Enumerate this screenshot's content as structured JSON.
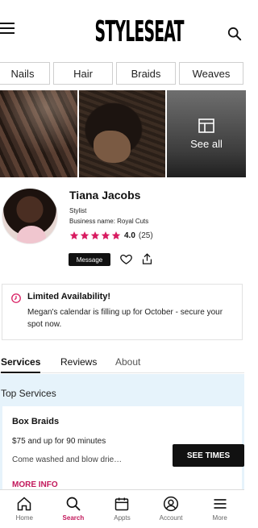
{
  "header": {
    "logo": "STYLESEAT"
  },
  "categories": [
    "Nails",
    "Hair",
    "Braids",
    "Weaves"
  ],
  "photos": {
    "see_all_label": "See all"
  },
  "profile": {
    "name": "Tiana Jacobs",
    "role": "Stylist",
    "business": "Business name: Royal Cuts",
    "rating": "4.0",
    "rating_count": "(25)",
    "stars_total": 5,
    "star_color": "#d81b60",
    "message_label": "Message"
  },
  "availability": {
    "title": "Limited Availability!",
    "text": "Megan's calendar is filling up for October - secure your spot now."
  },
  "tabs": [
    "Services",
    "Reviews",
    "About"
  ],
  "services": {
    "heading": "Top Services",
    "items": [
      {
        "name": "Box Braids",
        "price": "$75 and up for 90 minutes",
        "description": "Come washed and blow drie…",
        "more_label": "MORE INFO",
        "cta_label": "SEE TIMES"
      }
    ]
  },
  "bottom_nav": [
    {
      "label": "Home",
      "icon": "home-icon"
    },
    {
      "label": "Search",
      "icon": "search-icon",
      "active": true
    },
    {
      "label": "Appts",
      "icon": "calendar-icon"
    },
    {
      "label": "Account",
      "icon": "account-icon"
    },
    {
      "label": "More",
      "icon": "menu-icon"
    }
  ],
  "colors": {
    "accent": "#c2185b",
    "services_bg": "#e6f3fb"
  }
}
